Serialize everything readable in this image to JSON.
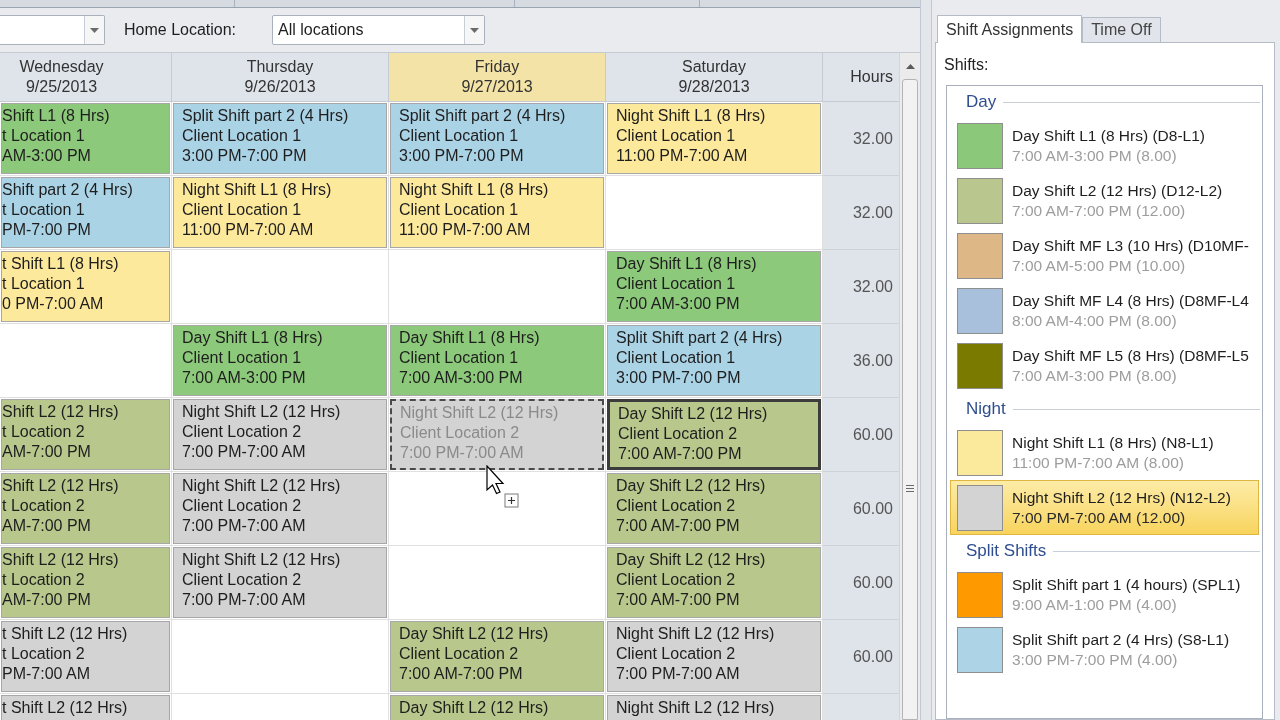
{
  "toolbar": {
    "home_location": {
      "label": "Home Location:",
      "value": "All locations"
    }
  },
  "grid": {
    "columns": [
      {
        "day": "Wednesday",
        "date": "9/25/2013",
        "selected": false
      },
      {
        "day": "Thursday",
        "date": "9/26/2013",
        "selected": false
      },
      {
        "day": "Friday",
        "date": "9/27/2013",
        "selected": true
      },
      {
        "day": "Saturday",
        "date": "9/28/2013",
        "selected": false
      }
    ],
    "hours_header": "Hours",
    "rows": [
      {
        "hours": "32.00",
        "cells": [
          {
            "kind": "shift",
            "color": "#8cc97a",
            "title": "Shift L1 (8 Hrs)",
            "location": "t Location 1",
            "time": "AM-3:00 PM",
            "selected": false,
            "dragging": false
          },
          {
            "kind": "shift",
            "color": "#abd3e6",
            "title": "Split Shift part 2 (4 Hrs)",
            "location": "Client Location 1",
            "time": "3:00 PM-7:00 PM",
            "selected": false,
            "dragging": false
          },
          {
            "kind": "shift",
            "color": "#abd3e6",
            "title": "Split Shift part 2 (4 Hrs)",
            "location": "Client Location 1",
            "time": "3:00 PM-7:00 PM",
            "selected": false,
            "dragging": false
          },
          {
            "kind": "shift",
            "color": "#fde99b",
            "title": "Night Shift L1 (8 Hrs)",
            "location": "Client Location 1",
            "time": "11:00 PM-7:00 AM",
            "selected": false,
            "dragging": false
          }
        ]
      },
      {
        "hours": "32.00",
        "cells": [
          {
            "kind": "shift",
            "color": "#abd3e6",
            "title": "Shift part 2 (4 Hrs)",
            "location": "t Location 1",
            "time": "PM-7:00 PM",
            "selected": false,
            "dragging": false
          },
          {
            "kind": "shift",
            "color": "#fde99b",
            "title": "Night Shift L1 (8 Hrs)",
            "location": "Client Location 1",
            "time": "11:00 PM-7:00 AM",
            "selected": false,
            "dragging": false
          },
          {
            "kind": "shift",
            "color": "#fde99b",
            "title": "Night Shift L1 (8 Hrs)",
            "location": "Client Location 1",
            "time": "11:00 PM-7:00 AM",
            "selected": false,
            "dragging": false
          },
          {
            "kind": "empty"
          }
        ]
      },
      {
        "hours": "32.00",
        "cells": [
          {
            "kind": "shift",
            "color": "#fde99b",
            "title": "t Shift L1 (8 Hrs)",
            "location": "t Location 1",
            "time": "0 PM-7:00 AM",
            "selected": false,
            "dragging": false
          },
          {
            "kind": "empty"
          },
          {
            "kind": "empty"
          },
          {
            "kind": "shift",
            "color": "#8cc97a",
            "title": "Day Shift L1 (8 Hrs)",
            "location": "Client Location 1",
            "time": "7:00 AM-3:00 PM",
            "selected": false,
            "dragging": false
          }
        ]
      },
      {
        "hours": "36.00",
        "cells": [
          {
            "kind": "empty"
          },
          {
            "kind": "shift",
            "color": "#8cc97a",
            "title": "Day Shift L1 (8 Hrs)",
            "location": "Client Location 1",
            "time": "7:00 AM-3:00 PM",
            "selected": false,
            "dragging": false
          },
          {
            "kind": "shift",
            "color": "#8cc97a",
            "title": "Day Shift L1 (8 Hrs)",
            "location": "Client Location 1",
            "time": "7:00 AM-3:00 PM",
            "selected": false,
            "dragging": false
          },
          {
            "kind": "shift",
            "color": "#abd3e6",
            "title": "Split Shift part 2 (4 Hrs)",
            "location": "Client Location 1",
            "time": "3:00 PM-7:00 PM",
            "selected": false,
            "dragging": false
          }
        ]
      },
      {
        "hours": "60.00",
        "cells": [
          {
            "kind": "shift",
            "color": "#b8c78c",
            "title": "Shift L2 (12 Hrs)",
            "location": "t Location 2",
            "time": "AM-7:00 PM",
            "selected": false,
            "dragging": false
          },
          {
            "kind": "shift",
            "color": "#d3d3d3",
            "title": "Night Shift L2 (12 Hrs)",
            "location": "Client Location 2",
            "time": "7:00 PM-7:00 AM",
            "selected": false,
            "dragging": false
          },
          {
            "kind": "shift",
            "color": "#d3d3d3",
            "title": "Night Shift L2 (12 Hrs)",
            "location": "Client Location 2",
            "time": "7:00 PM-7:00 AM",
            "selected": false,
            "dragging": true
          },
          {
            "kind": "shift",
            "color": "#b8c78c",
            "title": "Day Shift L2 (12 Hrs)",
            "location": "Client Location 2",
            "time": "7:00 AM-7:00 PM",
            "selected": true,
            "dragging": false
          }
        ]
      },
      {
        "hours": "60.00",
        "cells": [
          {
            "kind": "shift",
            "color": "#b8c78c",
            "title": "Shift L2 (12 Hrs)",
            "location": "t Location 2",
            "time": "AM-7:00 PM",
            "selected": false,
            "dragging": false
          },
          {
            "kind": "shift",
            "color": "#d3d3d3",
            "title": "Night Shift L2 (12 Hrs)",
            "location": "Client Location 2",
            "time": "7:00 PM-7:00 AM",
            "selected": false,
            "dragging": false
          },
          {
            "kind": "empty"
          },
          {
            "kind": "shift",
            "color": "#b8c78c",
            "title": "Day Shift L2 (12 Hrs)",
            "location": "Client Location 2",
            "time": "7:00 AM-7:00 PM",
            "selected": false,
            "dragging": false
          }
        ]
      },
      {
        "hours": "60.00",
        "cells": [
          {
            "kind": "shift",
            "color": "#b8c78c",
            "title": "Shift L2 (12 Hrs)",
            "location": "t Location 2",
            "time": "AM-7:00 PM",
            "selected": false,
            "dragging": false
          },
          {
            "kind": "shift",
            "color": "#d3d3d3",
            "title": "Night Shift L2 (12 Hrs)",
            "location": "Client Location 2",
            "time": "7:00 PM-7:00 AM",
            "selected": false,
            "dragging": false
          },
          {
            "kind": "empty"
          },
          {
            "kind": "shift",
            "color": "#b8c78c",
            "title": "Day Shift L2 (12 Hrs)",
            "location": "Client Location 2",
            "time": "7:00 AM-7:00 PM",
            "selected": false,
            "dragging": false
          }
        ]
      },
      {
        "hours": "60.00",
        "cells": [
          {
            "kind": "shift",
            "color": "#d3d3d3",
            "title": "t Shift L2 (12 Hrs)",
            "location": "t Location 2",
            "time": "PM-7:00 AM",
            "selected": false,
            "dragging": false
          },
          {
            "kind": "empty"
          },
          {
            "kind": "shift",
            "color": "#b8c78c",
            "title": "Day Shift L2 (12 Hrs)",
            "location": "Client Location 2",
            "time": "7:00 AM-7:00 PM",
            "selected": false,
            "dragging": false
          },
          {
            "kind": "shift",
            "color": "#d3d3d3",
            "title": "Night Shift L2 (12 Hrs)",
            "location": "Client Location 2",
            "time": "7:00 PM-7:00 AM",
            "selected": false,
            "dragging": false
          }
        ]
      },
      {
        "cells": [
          {
            "kind": "shift",
            "color": "#d3d3d3",
            "title": "t Shift L2 (12 Hrs)",
            "selected": false,
            "dragging": false
          },
          {
            "kind": "empty"
          },
          {
            "kind": "shift",
            "color": "#b8c78c",
            "title": "Day Shift L2 (12 Hrs)",
            "selected": false,
            "dragging": false
          },
          {
            "kind": "shift",
            "color": "#d3d3d3",
            "title": "Night Shift L2 (12 Hrs)",
            "selected": false,
            "dragging": false
          }
        ]
      }
    ]
  },
  "side_panel": {
    "tabs": [
      {
        "label": "Shift Assignments",
        "selected": true
      },
      {
        "label": "Time Off",
        "selected": false
      }
    ],
    "shifts_label": "Shifts:",
    "groups": [
      {
        "title": "Day",
        "items": [
          {
            "name": "Day Shift L1 (8 Hrs) (D8-L1)",
            "time": "7:00 AM-3:00 PM (8.00)",
            "color": "#8cc87a",
            "selected": false
          },
          {
            "name": "Day Shift L2 (12 Hrs) (D12-L2)",
            "time": "7:00 AM-7:00 PM (12.00)",
            "color": "#b9c68e",
            "selected": false
          },
          {
            "name": "Day Shift MF L3 (10 Hrs) (D10MF-",
            "time": "7:00 AM-5:00 PM (10.00)",
            "color": "#ddb786",
            "selected": false
          },
          {
            "name": "Day Shift MF L4 (8 Hrs) (D8MF-L4",
            "time": "8:00 AM-4:00 PM (8.00)",
            "color": "#a9c0dc",
            "selected": false
          },
          {
            "name": "Day Shift MF L5 (8 Hrs) (D8MF-L5",
            "time": "7:00 AM-3:00 PM (8.00)",
            "color": "#7a7a00",
            "selected": false
          }
        ]
      },
      {
        "title": "Night",
        "items": [
          {
            "name": "Night Shift L1 (8 Hrs) (N8-L1)",
            "time": "11:00 PM-7:00 AM (8.00)",
            "color": "#fbe99c",
            "selected": false
          },
          {
            "name": "Night Shift L2 (12 Hrs) (N12-L2)",
            "time": "7:00 PM-7:00 AM (12.00)",
            "color": "#d3d3d3",
            "selected": true
          }
        ]
      },
      {
        "title": "Split Shifts",
        "items": [
          {
            "name": "Split Shift part 1 (4 hours) (SPL1)",
            "time": "9:00 AM-1:00 PM (4.00)",
            "color": "#ff9900",
            "selected": false
          },
          {
            "name": "Split Shift part 2 (4 Hrs) (S8-L1)",
            "time": "3:00 PM-7:00 PM (4.00)",
            "color": "#acd4e6",
            "selected": false
          }
        ]
      }
    ]
  }
}
